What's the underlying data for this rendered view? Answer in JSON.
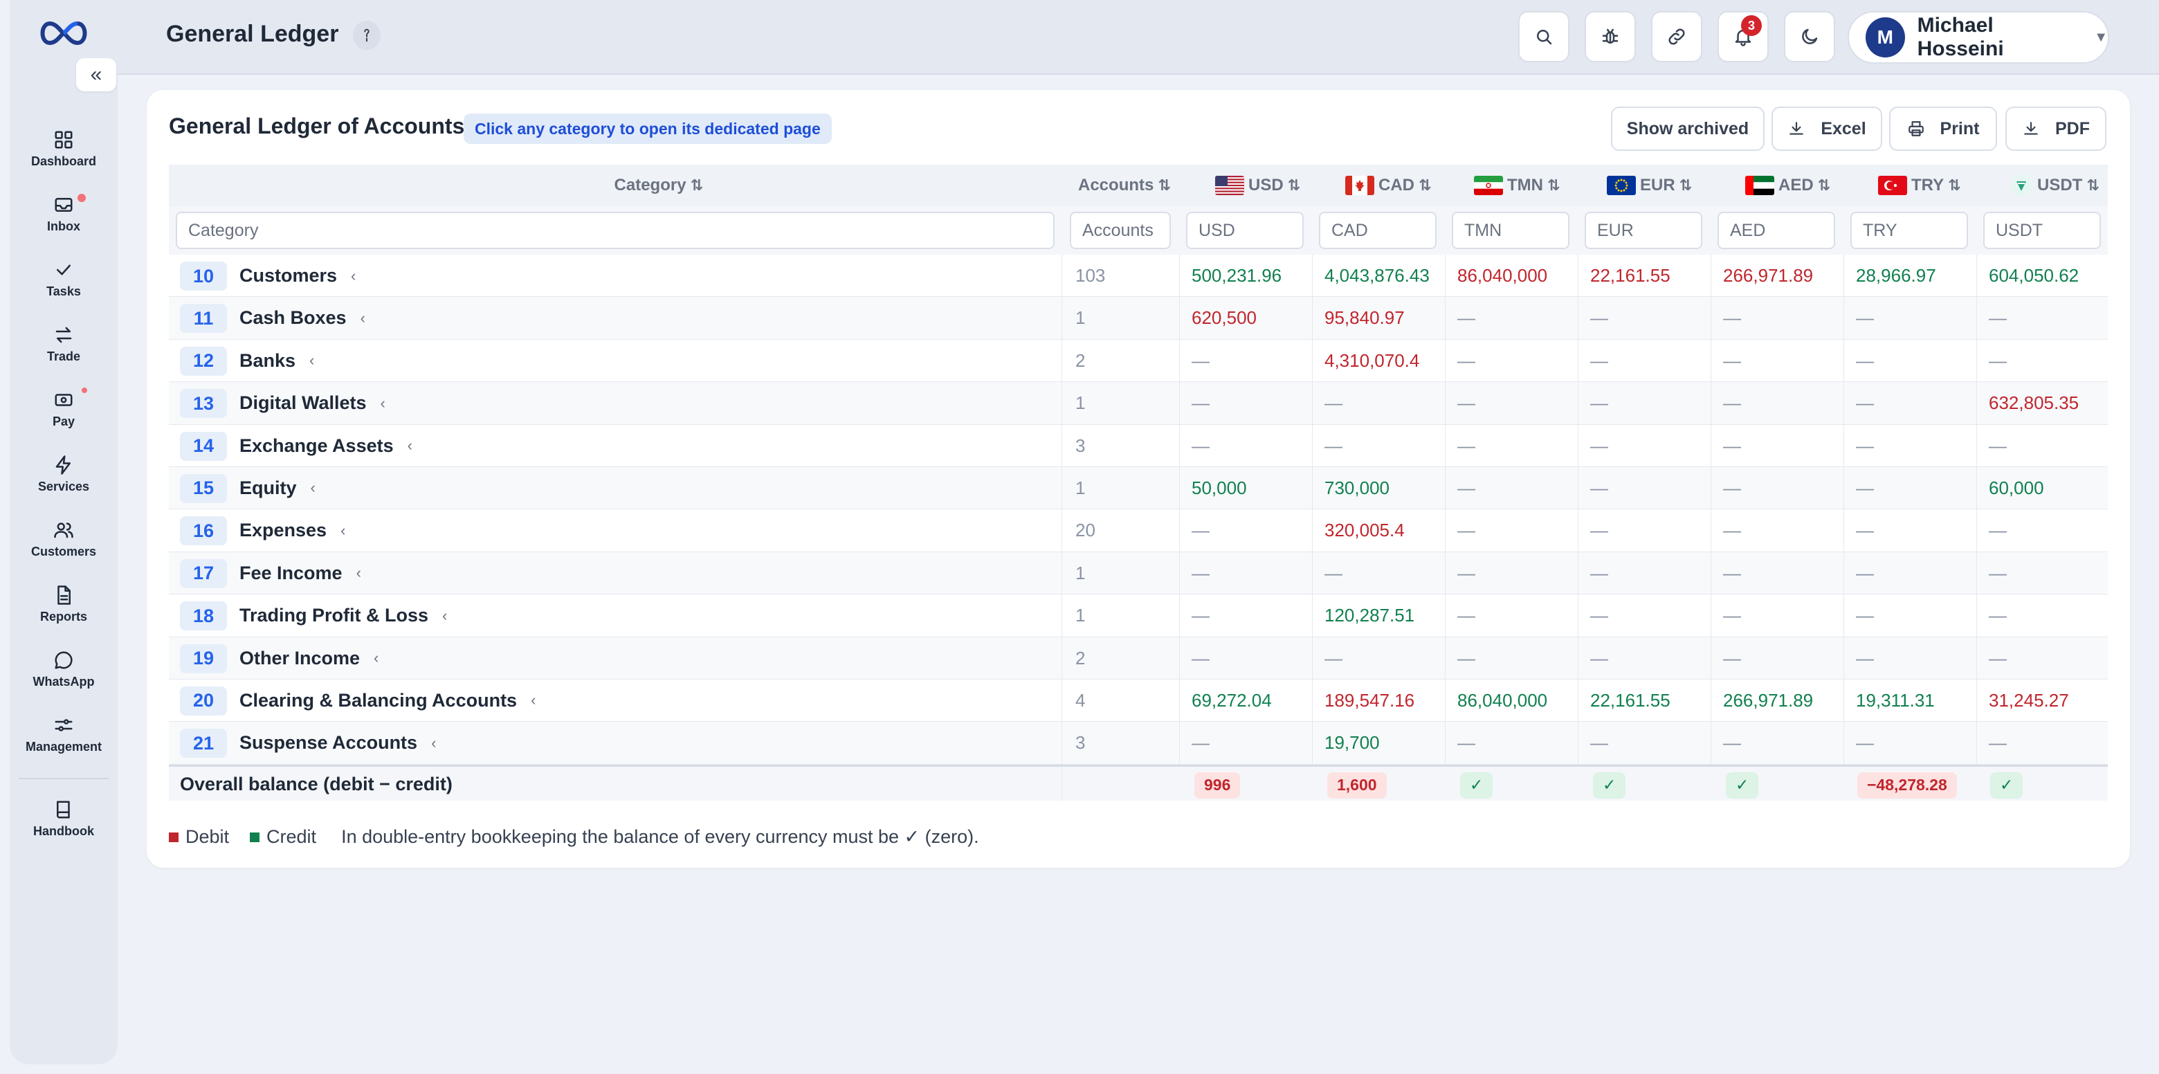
{
  "sidebar": {
    "items": [
      {
        "label": "Dashboard",
        "icon": "grid-icon"
      },
      {
        "label": "Inbox",
        "icon": "inbox-icon"
      },
      {
        "label": "Tasks",
        "icon": "check-icon"
      },
      {
        "label": "Trade",
        "icon": "arrows-icon"
      },
      {
        "label": "Pay",
        "icon": "cash-icon"
      },
      {
        "label": "Services",
        "icon": "bolt-icon"
      },
      {
        "label": "Customers",
        "icon": "users-icon"
      },
      {
        "label": "Reports",
        "icon": "file-icon"
      },
      {
        "label": "WhatsApp",
        "icon": "chat-icon"
      },
      {
        "label": "Management",
        "icon": "sliders-icon"
      }
    ],
    "handbook": "Handbook"
  },
  "header": {
    "title": "General Ledger",
    "notification_count": "3",
    "user": {
      "initial": "M",
      "name": "Michael Hosseini"
    }
  },
  "card": {
    "title": "General Ledger of Accounts",
    "hint": "Click any category to open its dedicated page",
    "buttons": {
      "archived": "Show archived",
      "excel": "Excel",
      "print": "Print",
      "pdf": "PDF"
    }
  },
  "table": {
    "headers": {
      "category": "Category",
      "accounts": "Accounts",
      "usd": "USD",
      "cad": "CAD",
      "tmn": "TMN",
      "eur": "EUR",
      "aed": "AED",
      "try": "TRY",
      "usdt": "USDT"
    },
    "filters": {
      "category": "Category",
      "accounts": "Accounts",
      "usd": "USD",
      "cad": "CAD",
      "tmn": "TMN",
      "eur": "EUR",
      "aed": "AED",
      "try": "TRY",
      "usdt": "USDT"
    },
    "rows": [
      {
        "code": "10",
        "name": "Customers",
        "accounts": "103",
        "vals": [
          [
            "500,231.96",
            "c"
          ],
          [
            "4,043,876.43",
            "c"
          ],
          [
            "86,040,000",
            "d"
          ],
          [
            "22,161.55",
            "d"
          ],
          [
            "266,971.89",
            "d"
          ],
          [
            "28,966.97",
            "c"
          ],
          [
            "604,050.62",
            "c"
          ]
        ]
      },
      {
        "code": "11",
        "name": "Cash Boxes",
        "accounts": "1",
        "vals": [
          [
            "620,500",
            "d"
          ],
          [
            "95,840.97",
            "d"
          ],
          [
            "—",
            "n"
          ],
          [
            "—",
            "n"
          ],
          [
            "—",
            "n"
          ],
          [
            "—",
            "n"
          ],
          [
            "—",
            "n"
          ]
        ]
      },
      {
        "code": "12",
        "name": "Banks",
        "accounts": "2",
        "vals": [
          [
            "—",
            "n"
          ],
          [
            "4,310,070.4",
            "d"
          ],
          [
            "—",
            "n"
          ],
          [
            "—",
            "n"
          ],
          [
            "—",
            "n"
          ],
          [
            "—",
            "n"
          ],
          [
            "—",
            "n"
          ]
        ]
      },
      {
        "code": "13",
        "name": "Digital Wallets",
        "accounts": "1",
        "vals": [
          [
            "—",
            "n"
          ],
          [
            "—",
            "n"
          ],
          [
            "—",
            "n"
          ],
          [
            "—",
            "n"
          ],
          [
            "—",
            "n"
          ],
          [
            "—",
            "n"
          ],
          [
            "632,805.35",
            "d"
          ]
        ]
      },
      {
        "code": "14",
        "name": "Exchange Assets",
        "accounts": "3",
        "vals": [
          [
            "—",
            "n"
          ],
          [
            "—",
            "n"
          ],
          [
            "—",
            "n"
          ],
          [
            "—",
            "n"
          ],
          [
            "—",
            "n"
          ],
          [
            "—",
            "n"
          ],
          [
            "—",
            "n"
          ]
        ]
      },
      {
        "code": "15",
        "name": "Equity",
        "accounts": "1",
        "vals": [
          [
            "50,000",
            "c"
          ],
          [
            "730,000",
            "c"
          ],
          [
            "—",
            "n"
          ],
          [
            "—",
            "n"
          ],
          [
            "—",
            "n"
          ],
          [
            "—",
            "n"
          ],
          [
            "60,000",
            "c"
          ]
        ]
      },
      {
        "code": "16",
        "name": "Expenses",
        "accounts": "20",
        "vals": [
          [
            "—",
            "n"
          ],
          [
            "320,005.4",
            "d"
          ],
          [
            "—",
            "n"
          ],
          [
            "—",
            "n"
          ],
          [
            "—",
            "n"
          ],
          [
            "—",
            "n"
          ],
          [
            "—",
            "n"
          ]
        ]
      },
      {
        "code": "17",
        "name": "Fee Income",
        "accounts": "1",
        "vals": [
          [
            "—",
            "n"
          ],
          [
            "—",
            "n"
          ],
          [
            "—",
            "n"
          ],
          [
            "—",
            "n"
          ],
          [
            "—",
            "n"
          ],
          [
            "—",
            "n"
          ],
          [
            "—",
            "n"
          ]
        ]
      },
      {
        "code": "18",
        "name": "Trading Profit & Loss",
        "accounts": "1",
        "vals": [
          [
            "—",
            "n"
          ],
          [
            "120,287.51",
            "c"
          ],
          [
            "—",
            "n"
          ],
          [
            "—",
            "n"
          ],
          [
            "—",
            "n"
          ],
          [
            "—",
            "n"
          ],
          [
            "—",
            "n"
          ]
        ]
      },
      {
        "code": "19",
        "name": "Other Income",
        "accounts": "2",
        "vals": [
          [
            "—",
            "n"
          ],
          [
            "—",
            "n"
          ],
          [
            "—",
            "n"
          ],
          [
            "—",
            "n"
          ],
          [
            "—",
            "n"
          ],
          [
            "—",
            "n"
          ],
          [
            "—",
            "n"
          ]
        ]
      },
      {
        "code": "20",
        "name": "Clearing & Balancing Accounts",
        "accounts": "4",
        "vals": [
          [
            "69,272.04",
            "c"
          ],
          [
            "189,547.16",
            "d"
          ],
          [
            "86,040,000",
            "c"
          ],
          [
            "22,161.55",
            "c"
          ],
          [
            "266,971.89",
            "c"
          ],
          [
            "19,311.31",
            "c"
          ],
          [
            "31,245.27",
            "d"
          ]
        ]
      },
      {
        "code": "21",
        "name": "Suspense Accounts",
        "accounts": "3",
        "vals": [
          [
            "—",
            "n"
          ],
          [
            "19,700",
            "c"
          ],
          [
            "—",
            "n"
          ],
          [
            "—",
            "n"
          ],
          [
            "—",
            "n"
          ],
          [
            "—",
            "n"
          ],
          [
            "—",
            "n"
          ]
        ]
      }
    ],
    "total": {
      "label": "Overall balance (debit − credit)",
      "vals": [
        [
          "996",
          "red"
        ],
        [
          "1,600",
          "red"
        ],
        [
          "✓",
          "green"
        ],
        [
          "✓",
          "green"
        ],
        [
          "✓",
          "green"
        ],
        [
          "−48,278.28",
          "red"
        ],
        [
          "✓",
          "green"
        ]
      ]
    }
  },
  "legend": {
    "debit": "Debit",
    "credit": "Credit",
    "note": "In double-entry bookkeeping the balance of every currency must be ✓ (zero).",
    "debit_color": "#c0262d",
    "credit_color": "#11804f"
  }
}
